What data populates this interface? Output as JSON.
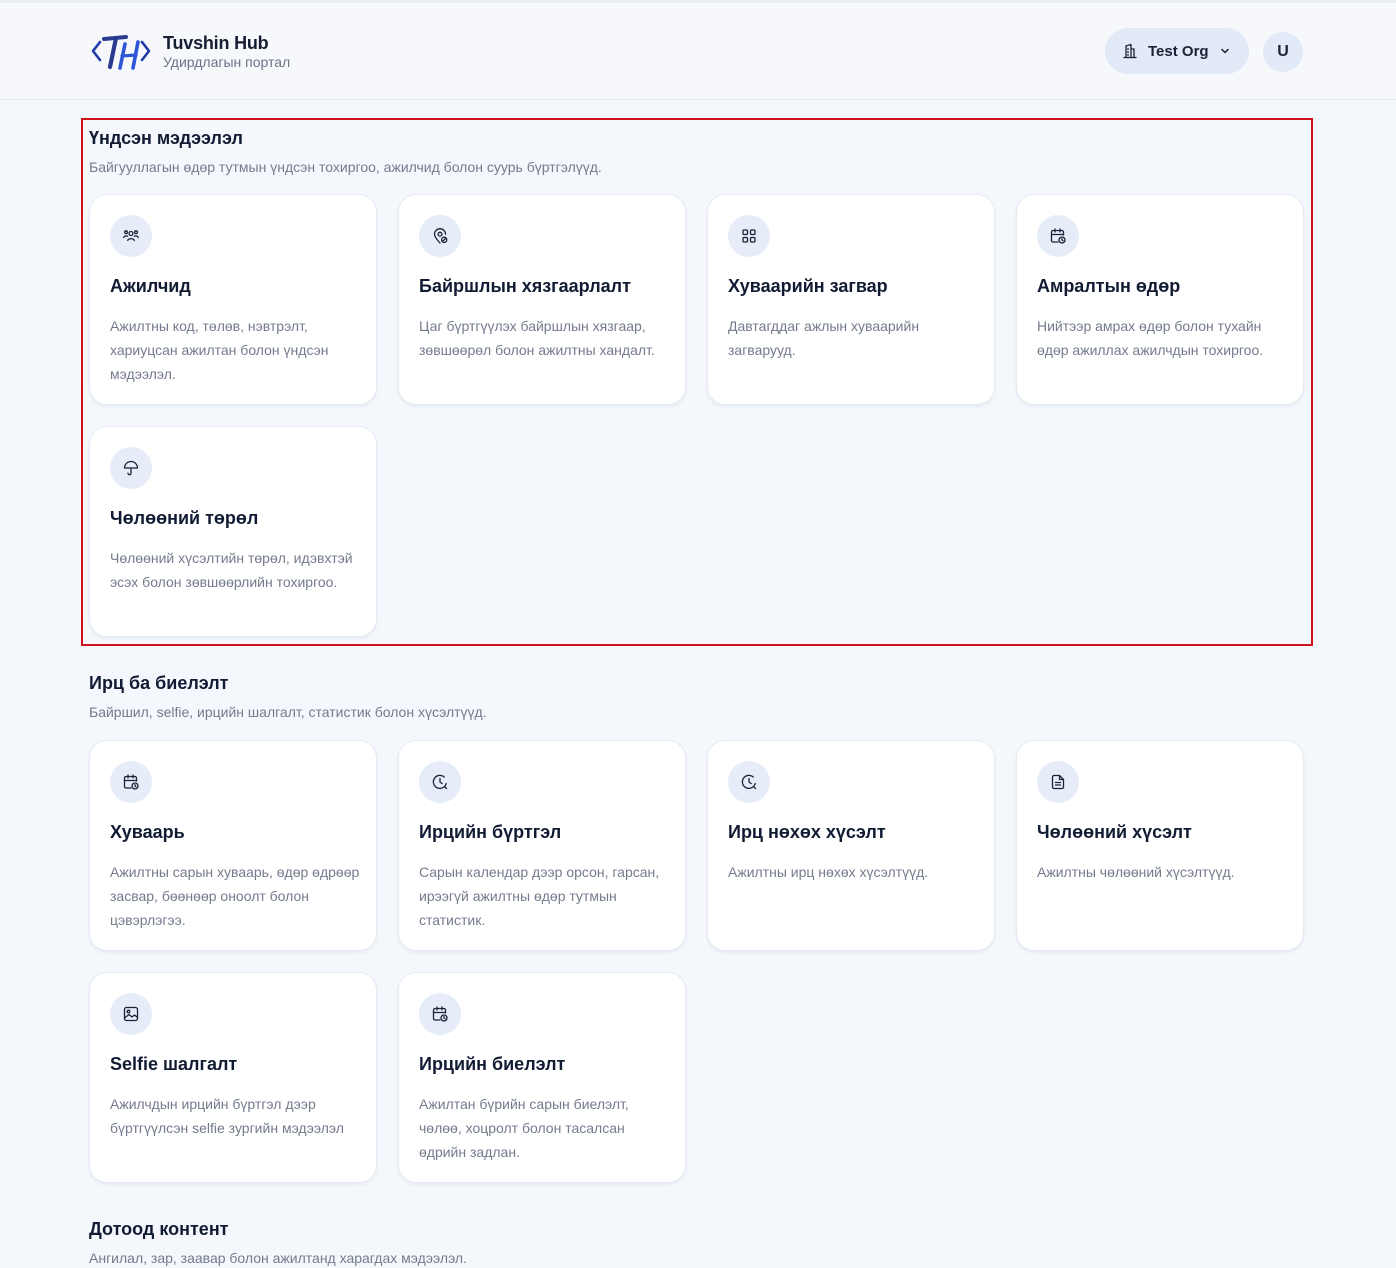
{
  "header": {
    "brand_title": "Tuvshin Hub",
    "brand_subtitle": "Удирдлагын портал",
    "org_label": "Test Org",
    "avatar_letter": "U"
  },
  "sections": [
    {
      "title": "Үндсэн мэдээлэл",
      "subtitle": "Байгууллагын өдөр тутмын үндсэн тохиргоо, ажилчид болон суурь бүртгэлүүд.",
      "cards": [
        {
          "title": "Ажилчид",
          "desc": "Ажилтны код, төлөв, нэвтрэлт, хариуцсан ажилтан болон үндсэн мэдээлэл.",
          "icon": "users-icon"
        },
        {
          "title": "Байршлын хязгаарлалт",
          "desc": "Цаг бүртгүүлэх байршлын хязгаар, зөвшөөрөл болон ажилтны хандалт.",
          "icon": "location-pin-icon"
        },
        {
          "title": "Хуваарийн загвар",
          "desc": "Давтагддаг ажлын хуваарийн загварууд.",
          "icon": "grid-icon"
        },
        {
          "title": "Амралтын өдөр",
          "desc": "Нийтээр амрах өдөр болон тухайн өдөр ажиллах ажилчдын тохиргоо.",
          "icon": "calendar-clock-icon"
        },
        {
          "title": "Чөлөөний төрөл",
          "desc": "Чөлөөний хүсэлтийн төрөл, идэвхтэй эсэх болон зөвшөөрлийн тохиргоо.",
          "icon": "umbrella-icon"
        }
      ]
    },
    {
      "title": "Ирц ба биелэлт",
      "subtitle": "Байршил, selfie, ирцийн шалгалт, статистик болон хүсэлтүүд.",
      "cards": [
        {
          "title": "Хуваарь",
          "desc": "Ажилтны сарын хуваарь, өдөр өдрөөр засвар, бөөнөөр оноолт болон цэвэрлэгээ.",
          "icon": "calendar-clock-icon"
        },
        {
          "title": "Ирцийн бүртгэл",
          "desc": "Сарын календар дээр орсон, гарсан, ирээгүй ажилтны өдөр тутмын статистик.",
          "icon": "clock-icon"
        },
        {
          "title": "Ирц нөхөх хүсэлт",
          "desc": "Ажилтны ирц нөхөх хүсэлтүүд.",
          "icon": "clock-icon"
        },
        {
          "title": "Чөлөөний хүсэлт",
          "desc": "Ажилтны чөлөөний хүсэлтүүд.",
          "icon": "document-icon"
        },
        {
          "title": "Selfie шалгалт",
          "desc": "Ажилчдын ирцийн бүртгэл дээр бүртгүүлсэн selfie зургийн мэдээлэл",
          "icon": "image-icon"
        },
        {
          "title": "Ирцийн биелэлт",
          "desc": "Ажилтан бүрийн сарын биелэлт, чөлөө, хоцролт болон тасалсан өдрийн задлан.",
          "icon": "calendar-clock-icon"
        }
      ]
    },
    {
      "title": "Дотоод контент",
      "subtitle": "Ангилал, зар, заавар болон ажилтанд харагдах мэдээлэл.",
      "cards": []
    }
  ],
  "colors": {
    "background": "#f4f7fc",
    "card": "#ffffff",
    "icon_bg": "#e6ecf8",
    "logo_blue": "#1f3aa8",
    "highlight_red": "#d0121c"
  }
}
